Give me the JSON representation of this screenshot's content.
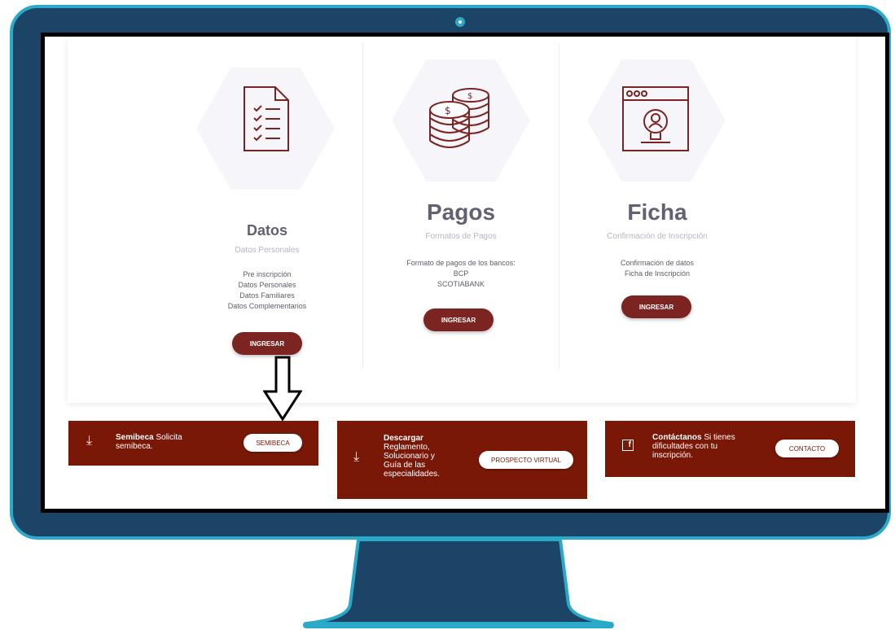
{
  "columns": [
    {
      "title": "Datos",
      "subtitle": "Datos Personales",
      "icon": "checklist-document-icon",
      "lines": [
        "Pre inscripción",
        "Datos Personales",
        "Datos Familiares",
        "Datos Complementarios"
      ],
      "button": "INGRESAR"
    },
    {
      "title": "Pagos",
      "subtitle": "Formatos de Pagos",
      "icon": "coins-stack-icon",
      "lines": [
        "Formato de pagos de los bancos:",
        "BCP",
        "SCOTIABANK"
      ],
      "button": "INGRESAR"
    },
    {
      "title": "Ficha",
      "subtitle": "Confirmación de Inscripción",
      "icon": "profile-window-icon",
      "lines": [
        "Confirmación de datos",
        "Ficha de Inscripción"
      ],
      "button": "INGRESAR"
    }
  ],
  "panels": {
    "semibeca": {
      "bold": "Semibeca",
      "text1": " Solicita",
      "text2": "semibeca.",
      "button": "SEMIBECA"
    },
    "descargar": {
      "bold": "Descargar",
      "lines": [
        "Reglamento,",
        "Solucionario y",
        "Guía de las",
        "especialidades."
      ],
      "button": "PROSPECTO VIRTUAL"
    },
    "contactanos": {
      "bold": "Contáctanos",
      "text1": " Si tienes",
      "text2": "dificultades con tu",
      "text3": "inscripción.",
      "button": "CONTACTO"
    }
  },
  "colors": {
    "frame": "#1c4466",
    "frame_border": "#2aa9c9",
    "accent": "#7b2422",
    "panel_red": "#7a1807"
  }
}
